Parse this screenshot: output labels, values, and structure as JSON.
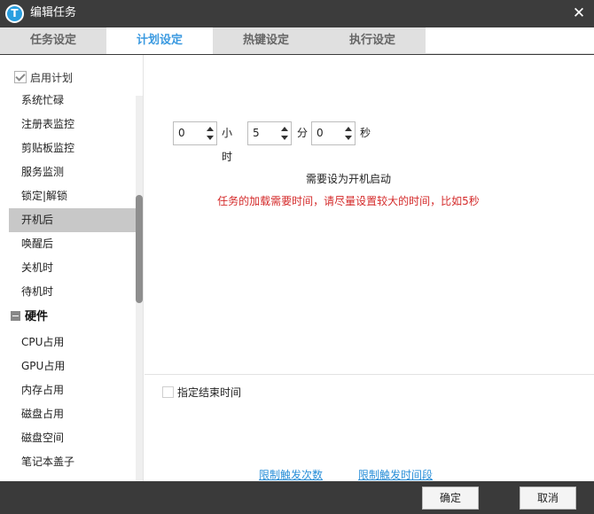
{
  "window": {
    "title": "编辑任务",
    "app_icon_letter": "T",
    "close_glyph": "✕"
  },
  "tabs": [
    {
      "label": "任务设定",
      "active": false
    },
    {
      "label": "计划设定",
      "active": true
    },
    {
      "label": "热键设定",
      "active": false
    },
    {
      "label": "执行设定",
      "active": false
    }
  ],
  "sidebar": {
    "enable_label": "启用计划",
    "enable_checked": true,
    "items": [
      "系统忙碌",
      "注册表监控",
      "剪贴板监控",
      "服务监测",
      "锁定|解锁",
      "开机后",
      "唤醒后",
      "关机时",
      "待机时"
    ],
    "selected": "开机后",
    "group": {
      "label": "硬件",
      "items": [
        "CPU占用",
        "GPU占用",
        "内存占用",
        "磁盘占用",
        "磁盘空间",
        "笔记本盖子"
      ]
    }
  },
  "delay": {
    "hours": "0",
    "hours_unit": "小时",
    "minutes": "5",
    "minutes_unit": "分",
    "seconds": "0",
    "seconds_unit": "秒"
  },
  "notes": {
    "boot": "需要设为开机启动",
    "warning": "任务的加载需要时间，请尽量设置较大的时间，比如5秒"
  },
  "end_time": {
    "label": "指定结束时间",
    "checked": false
  },
  "links": {
    "limit_count": "限制触发次数",
    "limit_interval": "限制触发时间段"
  },
  "buttons": {
    "ok": "确定",
    "cancel": "取消"
  },
  "colors": {
    "accent": "#3b9ae0",
    "warning": "#d42a2a",
    "link": "#2a8fd8",
    "titlebar": "#3c3c3c"
  }
}
